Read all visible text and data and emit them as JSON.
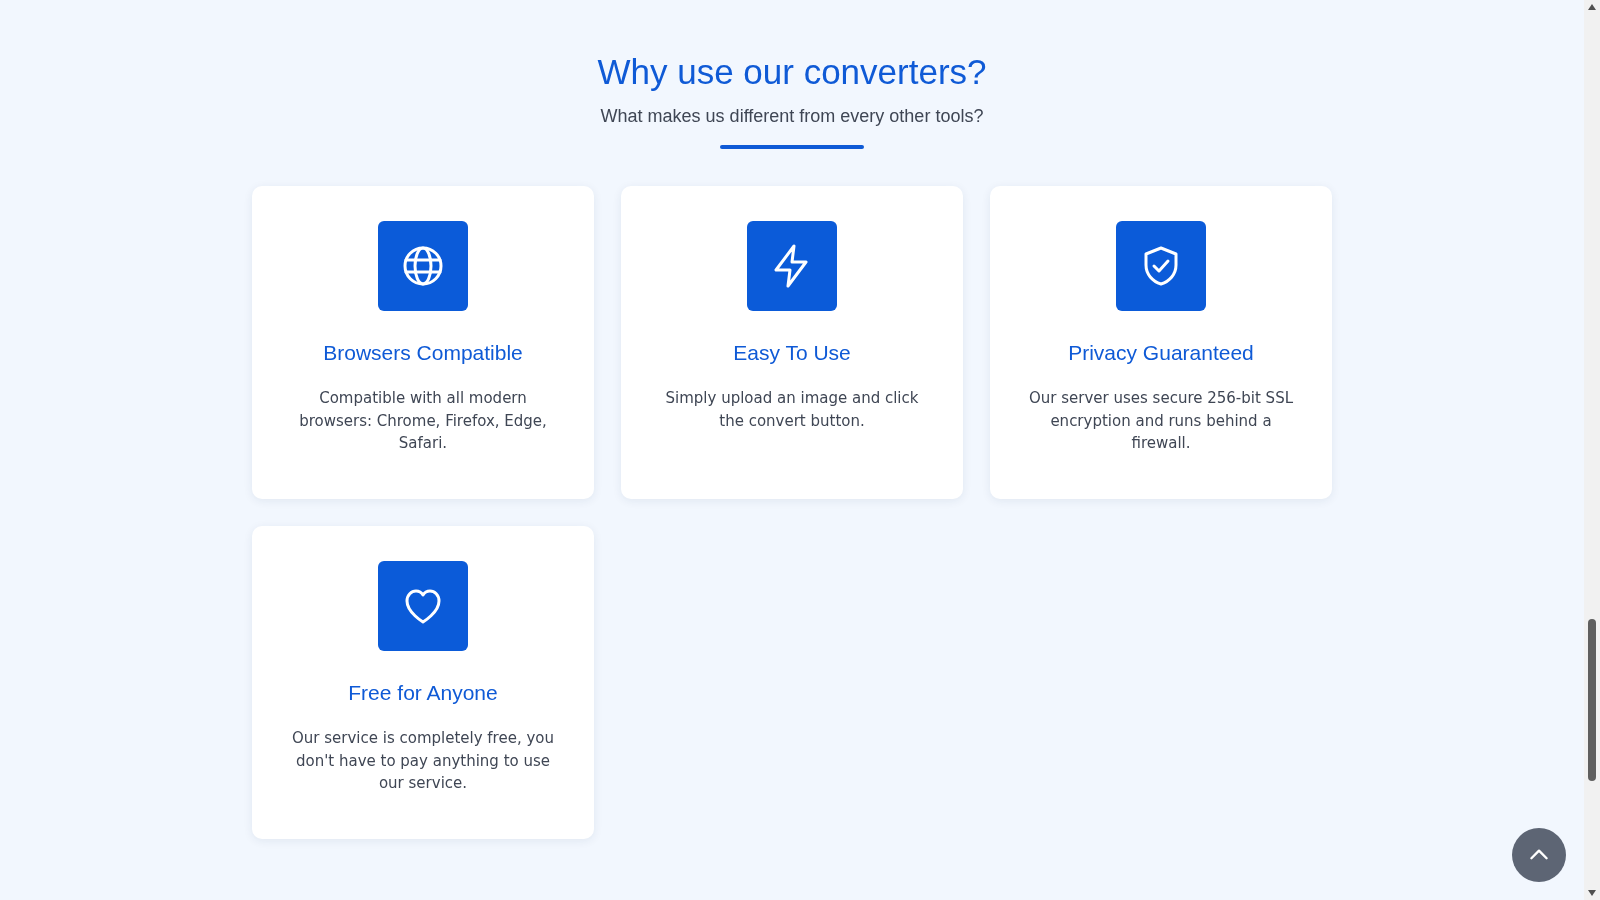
{
  "heading": "Why use our converters?",
  "subtitle": "What makes us different from every other tools?",
  "features": [
    {
      "kind": "globe",
      "title": "Browsers Compatible",
      "text": "Compatible with all modern browsers: Chrome, Firefox, Edge, Safari."
    },
    {
      "kind": "bolt",
      "title": "Easy To Use",
      "text": "Simply upload an image and click the convert button."
    },
    {
      "kind": "shield",
      "title": "Privacy Guaranteed",
      "text": "Our server uses secure 256-bit SSL encryption and runs behind a firewall."
    },
    {
      "kind": "heart",
      "title": "Free for Anyone",
      "text": "Our service is completely free, you don't have to pay anything to use our service."
    }
  ]
}
